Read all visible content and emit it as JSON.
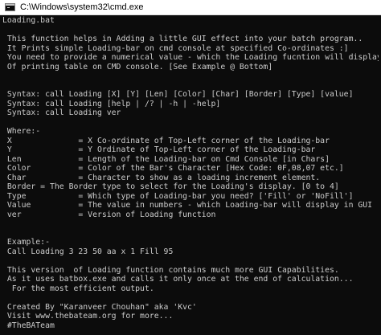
{
  "window": {
    "title": "C:\\Windows\\system32\\cmd.exe",
    "icon": "cmd-console-icon"
  },
  "console": {
    "lines": [
      "Loading.bat",
      "",
      " This function helps in Adding a little GUI effect into your batch program..",
      " It Prints simple Loading-bar on cmd console at specified Co-ordinates :]",
      " You need to provide a numerical value - which the Loading fucntion will display",
      " Of printing table on CMD console. [See Example @ Bottom]",
      "",
      "",
      " Syntax: call Loading [X] [Y] [Len] [Color] [Char] [Border] [Type] [value]",
      " Syntax: call Loading [help | /? | -h | -help]",
      " Syntax: call Loading ver",
      "",
      " Where:-",
      " X              = X Co-ordinate of Top-Left corner of the Loading-bar",
      " Y              = Y Ordinate of Top-Left corner of the Loading-bar",
      " Len            = Length of the Loading-bar on Cmd Console [in Chars]",
      " Color          = Color of the Bar's Character [Hex Code: 0F,08,07 etc.]",
      " Char           = Character to show as a loading increment element.",
      " Border = The Border type to select for the Loading's display. [0 to 4]",
      " Type           = Which type of Loading-bar you need? ['Fill' or 'NoFill']",
      " Value          = The value in numbers - which Loading-bar will display in GUI",
      " ver            = Version of Loading function",
      "",
      "",
      " Example:-",
      " Call Loading 3 23 50 aa x 1 Fill 95",
      "",
      " This version  of Loading function contains much more GUI Capabilities.",
      " As it uses batbox.exe and calls it only once at the end of calculation...",
      "  For the most efficient output.",
      "",
      " Created By \"Karanveer Chouhan\" aka 'Kvc'",
      " Visit www.thebateam.org for more...",
      " #TheBATeam"
    ]
  }
}
